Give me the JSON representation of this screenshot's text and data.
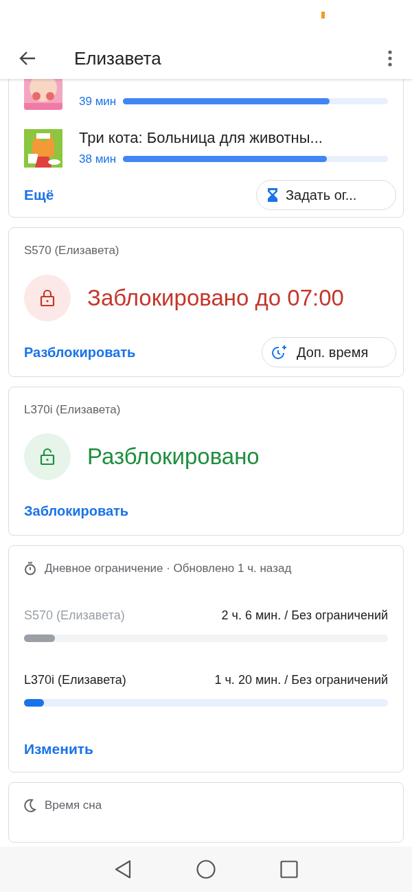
{
  "header": {
    "title": "Елизавета"
  },
  "apps": [
    {
      "usage": "39 мин",
      "level": 0.78
    },
    {
      "name": "Три кота: Больница для животны...",
      "usage": "38 мин",
      "level": 0.77
    }
  ],
  "apps_footer": {
    "more": "Ещё",
    "limit_button": "Задать ог..."
  },
  "devices": [
    {
      "kind": "locked",
      "name": "S570 (Елизавета)",
      "status": "Заблокировано до 07:00",
      "action": "Разблокировать",
      "extra_button": "Доп. время"
    },
    {
      "kind": "unlocked",
      "name": "L370i (Елизавета)",
      "status": "Разблокировано",
      "action": "Заблокировать"
    }
  ],
  "daily_limit": {
    "title": "Дневное ограничение · Обновлено 1 ч. назад",
    "rows": [
      {
        "device": "S570 (Елизавета)",
        "usage": "2 ч. 6 мин. / Без ограничений",
        "disabled": true,
        "level": 0.085
      },
      {
        "device": "L370i (Елизавета)",
        "usage": "1 ч. 20 мин. / Без ограничений",
        "disabled": false,
        "level": 0.055
      }
    ],
    "action": "Изменить"
  },
  "bedtime": {
    "title": "Время сна"
  }
}
